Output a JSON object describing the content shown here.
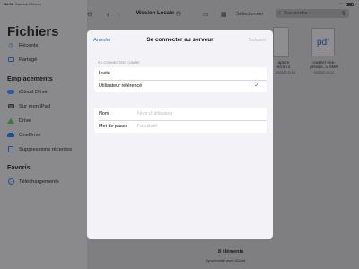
{
  "status_bar": {
    "time": "11:50",
    "date": "Samedi 4 février"
  },
  "sidebar": {
    "title": "Fichiers",
    "top_items": [
      {
        "label": "Récents",
        "icon": "clock-icon"
      },
      {
        "label": "Partagé",
        "icon": "shared-folder-icon"
      }
    ],
    "locations_header": "Emplacements",
    "locations": [
      {
        "label": "iCloud Drive",
        "icon": "cloud-icon"
      },
      {
        "label": "Sur mon iPad",
        "icon": "ipad-icon"
      },
      {
        "label": "Drive",
        "icon": "google-drive-icon"
      },
      {
        "label": "OneDrive",
        "icon": "onedrive-icon"
      },
      {
        "label": "Suppressions récentes",
        "icon": "trash-icon"
      }
    ],
    "favorites_header": "Favoris",
    "favorites": [
      {
        "label": "Téléchargements",
        "icon": "download-icon"
      }
    ]
  },
  "browser": {
    "folder_title": "Mission Locale",
    "select_label": "Sélectionner",
    "search_placeholder": "Recherche",
    "files": [
      {
        "name_line1": "apture",
        "name_line2": "écran 2",
        "meta": "02/2022 11:04"
      },
      {
        "name_line1": "courrier vice-",
        "name_line2": "préside...L SMH",
        "meta": "02/2022 18:22"
      }
    ],
    "item_count": "8 éléments",
    "sync_status": "Synchronisé avec iCloud"
  },
  "dialog": {
    "cancel_label": "Annuler",
    "title": "Se connecter au serveur",
    "next_label": "Suivant",
    "section_label": "SE CONNECTER COMME",
    "options": [
      {
        "label": "Invité",
        "selected": false
      },
      {
        "label": "Utilisateur référencé",
        "selected": true
      }
    ],
    "fields": [
      {
        "label": "Nom",
        "placeholder": "Nom d'utilisateur",
        "value": ""
      },
      {
        "label": "Mot de passe",
        "placeholder": "Facultatif",
        "value": ""
      }
    ]
  },
  "colors": {
    "accent": "#2f6fe0",
    "dim_overlay": "#7f7f82",
    "sheet_bg": "#f2f2f7"
  }
}
